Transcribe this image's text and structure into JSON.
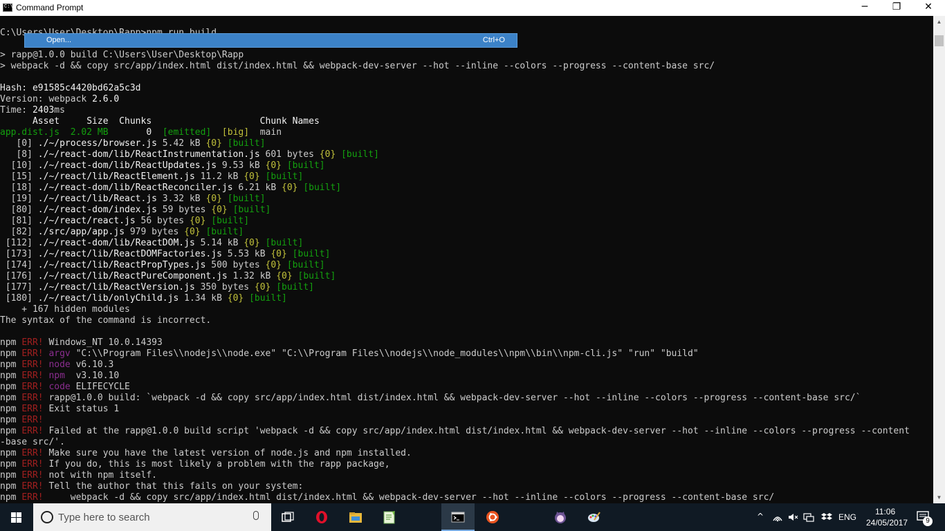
{
  "window": {
    "title": "Command Prompt",
    "minimize": "─",
    "maximize": "❐",
    "close": "✕"
  },
  "context_bar": {
    "label": "Open...",
    "shortcut": "Ctrl+O"
  },
  "console": {
    "lines": [
      [
        {
          "t": "C:\\Users\\User\\Desktop\\Rapp>npm run build"
        }
      ],
      [
        {
          "t": ""
        }
      ],
      [
        {
          "t": "> rapp@1.0.0 build C:\\Users\\User\\Desktop\\Rapp"
        }
      ],
      [
        {
          "t": "> webpack -d && copy src/app/index.html dist/index.html && webpack-dev-server --hot --inline --colors --progress --content-base src/"
        }
      ],
      [
        {
          "t": ""
        }
      ],
      [
        {
          "t": "Hash: ",
          "c": "c-bold"
        },
        {
          "t": "e91585c4420bd62a5c3d",
          "c": "c-white"
        }
      ],
      [
        {
          "t": "Version: webpack "
        },
        {
          "t": "2.6.0",
          "c": "c-white"
        }
      ],
      [
        {
          "t": "Time: "
        },
        {
          "t": "2403",
          "c": "c-white"
        },
        {
          "t": "ms"
        }
      ],
      [
        {
          "t": "      Asset     Size  Chunks                    Chunk Names",
          "c": "c-white"
        }
      ],
      [
        {
          "t": "app.dist.js  2.02 MB       ",
          "c": "c-green"
        },
        {
          "t": "0",
          "c": "c-white"
        },
        {
          "t": "  "
        },
        {
          "t": "[emitted]",
          "c": "c-green"
        },
        {
          "t": "  "
        },
        {
          "t": "[big]",
          "c": "c-yellow"
        },
        {
          "t": "  main"
        }
      ],
      [
        {
          "t": "   [0] "
        },
        {
          "t": "./~/process/browser.js",
          "c": "c-white"
        },
        {
          "t": " 5.42 kB "
        },
        {
          "t": "{0}",
          "c": "c-yellow"
        },
        {
          "t": " "
        },
        {
          "t": "[built]",
          "c": "c-green"
        }
      ],
      [
        {
          "t": "   [8] "
        },
        {
          "t": "./~/react-dom/lib/ReactInstrumentation.js",
          "c": "c-white"
        },
        {
          "t": " 601 bytes "
        },
        {
          "t": "{0}",
          "c": "c-yellow"
        },
        {
          "t": " "
        },
        {
          "t": "[built]",
          "c": "c-green"
        }
      ],
      [
        {
          "t": "  [10] "
        },
        {
          "t": "./~/react-dom/lib/ReactUpdates.js",
          "c": "c-white"
        },
        {
          "t": " 9.53 kB "
        },
        {
          "t": "{0}",
          "c": "c-yellow"
        },
        {
          "t": " "
        },
        {
          "t": "[built]",
          "c": "c-green"
        }
      ],
      [
        {
          "t": "  [15] "
        },
        {
          "t": "./~/react/lib/ReactElement.js",
          "c": "c-white"
        },
        {
          "t": " 11.2 kB "
        },
        {
          "t": "{0}",
          "c": "c-yellow"
        },
        {
          "t": " "
        },
        {
          "t": "[built]",
          "c": "c-green"
        }
      ],
      [
        {
          "t": "  [18] "
        },
        {
          "t": "./~/react-dom/lib/ReactReconciler.js",
          "c": "c-white"
        },
        {
          "t": " 6.21 kB "
        },
        {
          "t": "{0}",
          "c": "c-yellow"
        },
        {
          "t": " "
        },
        {
          "t": "[built]",
          "c": "c-green"
        }
      ],
      [
        {
          "t": "  [19] "
        },
        {
          "t": "./~/react/lib/React.js",
          "c": "c-white"
        },
        {
          "t": " 3.32 kB "
        },
        {
          "t": "{0}",
          "c": "c-yellow"
        },
        {
          "t": " "
        },
        {
          "t": "[built]",
          "c": "c-green"
        }
      ],
      [
        {
          "t": "  [80] "
        },
        {
          "t": "./~/react-dom/index.js",
          "c": "c-white"
        },
        {
          "t": " 59 bytes "
        },
        {
          "t": "{0}",
          "c": "c-yellow"
        },
        {
          "t": " "
        },
        {
          "t": "[built]",
          "c": "c-green"
        }
      ],
      [
        {
          "t": "  [81] "
        },
        {
          "t": "./~/react/react.js",
          "c": "c-white"
        },
        {
          "t": " 56 bytes "
        },
        {
          "t": "{0}",
          "c": "c-yellow"
        },
        {
          "t": " "
        },
        {
          "t": "[built]",
          "c": "c-green"
        }
      ],
      [
        {
          "t": "  [82] "
        },
        {
          "t": "./src/app/app.js",
          "c": "c-white"
        },
        {
          "t": " 979 bytes "
        },
        {
          "t": "{0}",
          "c": "c-yellow"
        },
        {
          "t": " "
        },
        {
          "t": "[built]",
          "c": "c-green"
        }
      ],
      [
        {
          "t": " [112] "
        },
        {
          "t": "./~/react-dom/lib/ReactDOM.js",
          "c": "c-white"
        },
        {
          "t": " 5.14 kB "
        },
        {
          "t": "{0}",
          "c": "c-yellow"
        },
        {
          "t": " "
        },
        {
          "t": "[built]",
          "c": "c-green"
        }
      ],
      [
        {
          "t": " [173] "
        },
        {
          "t": "./~/react/lib/ReactDOMFactories.js",
          "c": "c-white"
        },
        {
          "t": " 5.53 kB "
        },
        {
          "t": "{0}",
          "c": "c-yellow"
        },
        {
          "t": " "
        },
        {
          "t": "[built]",
          "c": "c-green"
        }
      ],
      [
        {
          "t": " [174] "
        },
        {
          "t": "./~/react/lib/ReactPropTypes.js",
          "c": "c-white"
        },
        {
          "t": " 500 bytes "
        },
        {
          "t": "{0}",
          "c": "c-yellow"
        },
        {
          "t": " "
        },
        {
          "t": "[built]",
          "c": "c-green"
        }
      ],
      [
        {
          "t": " [176] "
        },
        {
          "t": "./~/react/lib/ReactPureComponent.js",
          "c": "c-white"
        },
        {
          "t": " 1.32 kB "
        },
        {
          "t": "{0}",
          "c": "c-yellow"
        },
        {
          "t": " "
        },
        {
          "t": "[built]",
          "c": "c-green"
        }
      ],
      [
        {
          "t": " [177] "
        },
        {
          "t": "./~/react/lib/ReactVersion.js",
          "c": "c-white"
        },
        {
          "t": " 350 bytes "
        },
        {
          "t": "{0}",
          "c": "c-yellow"
        },
        {
          "t": " "
        },
        {
          "t": "[built]",
          "c": "c-green"
        }
      ],
      [
        {
          "t": " [180] "
        },
        {
          "t": "./~/react/lib/onlyChild.js",
          "c": "c-white"
        },
        {
          "t": " 1.34 kB "
        },
        {
          "t": "{0}",
          "c": "c-yellow"
        },
        {
          "t": " "
        },
        {
          "t": "[built]",
          "c": "c-green"
        }
      ],
      [
        {
          "t": "    + 167 hidden modules"
        }
      ],
      [
        {
          "t": "The syntax of the command is incorrect."
        }
      ],
      [
        {
          "t": ""
        }
      ],
      [
        {
          "t": "npm "
        },
        {
          "t": "ERR!",
          "c": "c-red"
        },
        {
          "t": " Windows_NT 10.0.14393"
        }
      ],
      [
        {
          "t": "npm "
        },
        {
          "t": "ERR!",
          "c": "c-red"
        },
        {
          "t": " "
        },
        {
          "t": "argv",
          "c": "c-magenta"
        },
        {
          "t": " \"C:\\\\Program Files\\\\nodejs\\\\node.exe\" \"C:\\\\Program Files\\\\nodejs\\\\node_modules\\\\npm\\\\bin\\\\npm-cli.js\" \"run\" \"build\""
        }
      ],
      [
        {
          "t": "npm "
        },
        {
          "t": "ERR!",
          "c": "c-red"
        },
        {
          "t": " "
        },
        {
          "t": "node",
          "c": "c-magenta"
        },
        {
          "t": " v6.10.3"
        }
      ],
      [
        {
          "t": "npm "
        },
        {
          "t": "ERR!",
          "c": "c-red"
        },
        {
          "t": " "
        },
        {
          "t": "npm",
          "c": "c-magenta"
        },
        {
          "t": "  v3.10.10"
        }
      ],
      [
        {
          "t": "npm "
        },
        {
          "t": "ERR!",
          "c": "c-red"
        },
        {
          "t": " "
        },
        {
          "t": "code",
          "c": "c-magenta"
        },
        {
          "t": " ELIFECYCLE"
        }
      ],
      [
        {
          "t": "npm "
        },
        {
          "t": "ERR!",
          "c": "c-red"
        },
        {
          "t": " rapp@1.0.0 build: `webpack -d && copy src/app/index.html dist/index.html && webpack-dev-server --hot --inline --colors --progress --content-base src/`"
        }
      ],
      [
        {
          "t": "npm "
        },
        {
          "t": "ERR!",
          "c": "c-red"
        },
        {
          "t": " Exit status 1"
        }
      ],
      [
        {
          "t": "npm "
        },
        {
          "t": "ERR!",
          "c": "c-red"
        }
      ],
      [
        {
          "t": "npm "
        },
        {
          "t": "ERR!",
          "c": "c-red"
        },
        {
          "t": " Failed at the rapp@1.0.0 build script 'webpack -d && copy src/app/index.html dist/index.html && webpack-dev-server --hot --inline --colors --progress --content"
        }
      ],
      [
        {
          "t": "-base src/'."
        }
      ],
      [
        {
          "t": "npm "
        },
        {
          "t": "ERR!",
          "c": "c-red"
        },
        {
          "t": " Make sure you have the latest version of node.js and npm installed."
        }
      ],
      [
        {
          "t": "npm "
        },
        {
          "t": "ERR!",
          "c": "c-red"
        },
        {
          "t": " If you do, this is most likely a problem with the rapp package,"
        }
      ],
      [
        {
          "t": "npm "
        },
        {
          "t": "ERR!",
          "c": "c-red"
        },
        {
          "t": " not with npm itself."
        }
      ],
      [
        {
          "t": "npm "
        },
        {
          "t": "ERR!",
          "c": "c-red"
        },
        {
          "t": " Tell the author that this fails on your system:"
        }
      ],
      [
        {
          "t": "npm "
        },
        {
          "t": "ERR!",
          "c": "c-red"
        },
        {
          "t": "     webpack -d && copy src/app/index.html dist/index.html && webpack-dev-server --hot --inline --colors --progress --content-base src/"
        }
      ]
    ]
  },
  "scrollbar": {
    "up": "▲",
    "down": "▼"
  },
  "taskbar": {
    "search_placeholder": "Type here to search",
    "apps": [
      {
        "name": "task-view",
        "icon": "task-view-icon"
      },
      {
        "name": "opera",
        "icon": "opera-icon"
      },
      {
        "name": "file-explorer",
        "icon": "folder-icon"
      },
      {
        "name": "notepad-plus",
        "icon": "notepad-icon"
      },
      {
        "name": "command-prompt",
        "icon": "terminal-icon",
        "active": true
      },
      {
        "name": "ubuntu",
        "icon": "ubuntu-icon"
      },
      {
        "name": "github-desktop",
        "icon": "cat-icon"
      },
      {
        "name": "paint",
        "icon": "palette-icon"
      }
    ],
    "tray": {
      "chevron": "^",
      "language": "ENG",
      "time": "11:06",
      "date": "24/05/2017",
      "notification_count": "9"
    }
  },
  "colors": {
    "console_bg": "#0c0c0c",
    "console_text": "#cccccc",
    "green": "#13a10e",
    "yellow": "#c1c13a",
    "red": "#a01f1f",
    "magenta": "#8a2d8f",
    "taskbar_bg": "#101a24",
    "popup_bg": "#3c82c8"
  }
}
